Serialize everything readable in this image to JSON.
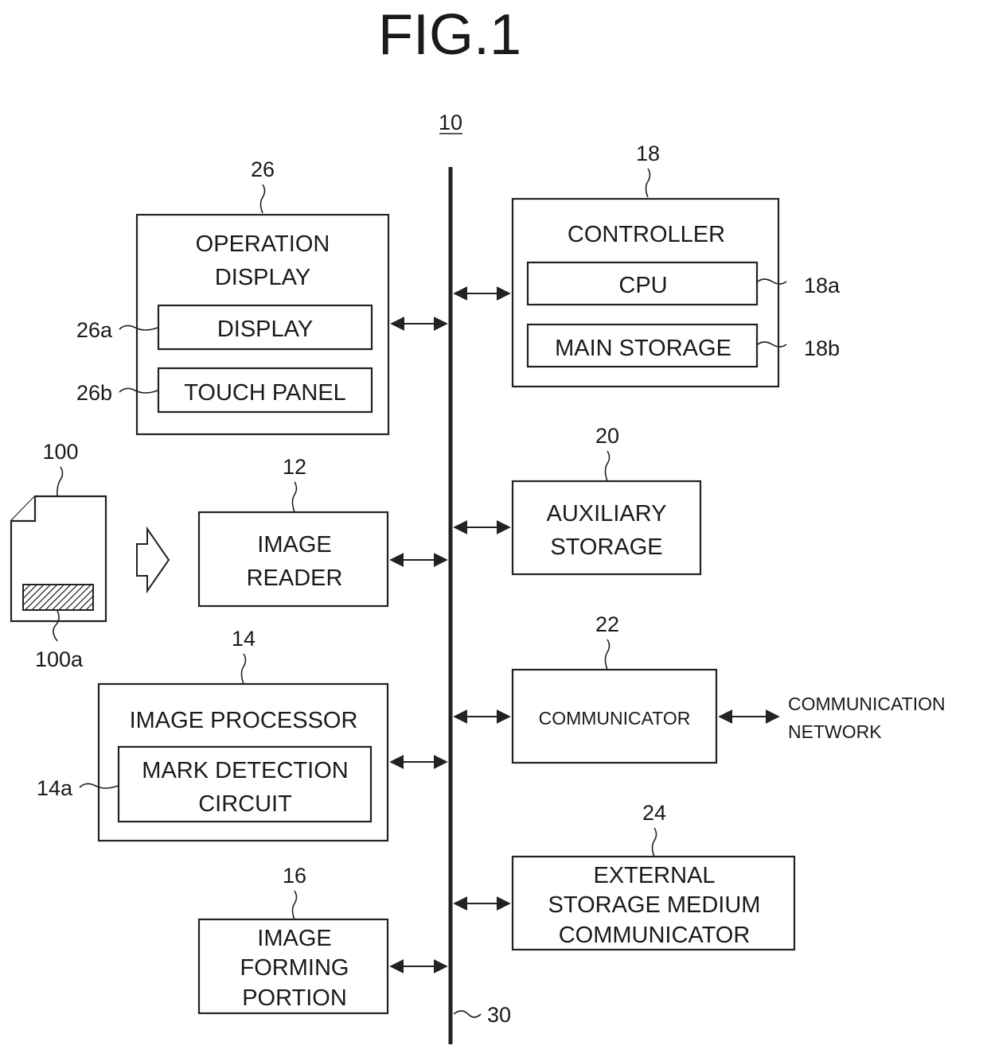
{
  "figure": {
    "title": "FIG.1",
    "device_ref": "10",
    "bus_ref": "30"
  },
  "blocks": {
    "operation_display": {
      "ref": "26",
      "line1": "OPERATION",
      "line2": "DISPLAY",
      "display": {
        "ref": "26a",
        "label": "DISPLAY"
      },
      "touch_panel": {
        "ref": "26b",
        "label": "TOUCH PANEL"
      }
    },
    "controller": {
      "ref": "18",
      "label": "CONTROLLER",
      "cpu": {
        "ref": "18a",
        "label": "CPU"
      },
      "main_storage": {
        "ref": "18b",
        "label": "MAIN STORAGE"
      }
    },
    "document": {
      "ref": "100",
      "mark_ref": "100a"
    },
    "image_reader": {
      "ref": "12",
      "line1": "IMAGE",
      "line2": "READER"
    },
    "auxiliary_storage": {
      "ref": "20",
      "line1": "AUXILIARY",
      "line2": "STORAGE"
    },
    "image_processor": {
      "ref": "14",
      "label": "IMAGE PROCESSOR",
      "mark_detection": {
        "ref": "14a",
        "line1": "MARK DETECTION",
        "line2": "CIRCUIT"
      }
    },
    "communicator": {
      "ref": "22",
      "label": "COMMUNICATOR",
      "network_line1": "COMMUNICATION",
      "network_line2": "NETWORK"
    },
    "external_storage": {
      "ref": "24",
      "line1": "EXTERNAL",
      "line2": "STORAGE MEDIUM",
      "line3": "COMMUNICATOR"
    },
    "image_forming": {
      "ref": "16",
      "line1": "IMAGE",
      "line2": "FORMING",
      "line3": "PORTION"
    }
  }
}
